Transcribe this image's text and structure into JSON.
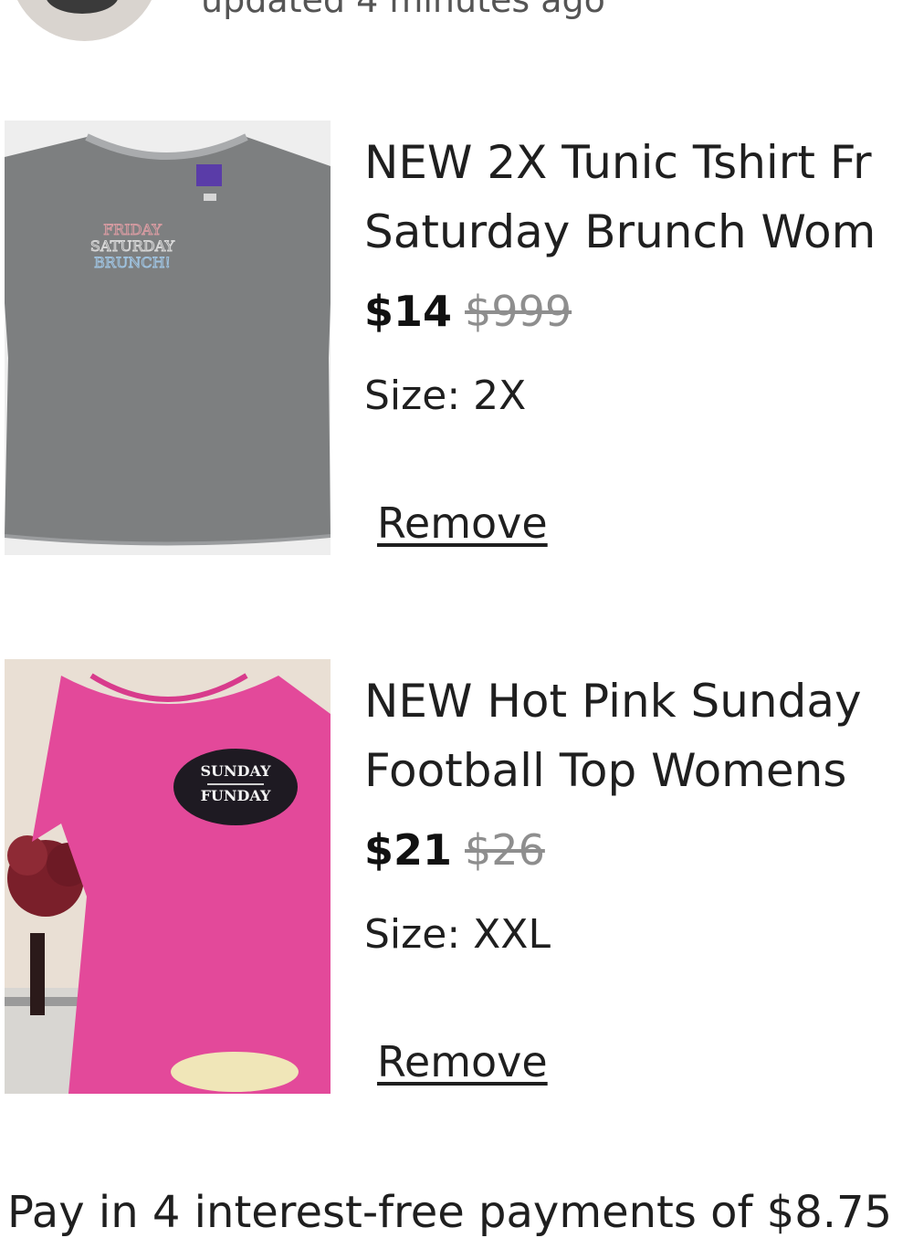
{
  "header": {
    "subtitle": "updated 4 minutes ago"
  },
  "cart": {
    "items": [
      {
        "title_line1": "NEW 2X Tunic Tshirt Fr",
        "title_line2": "Saturday Brunch Wom",
        "price": "$14",
        "original_price": "$999",
        "size_label": "Size:",
        "size_value": "2X",
        "remove_label": "Remove",
        "shirt_text": [
          "FRIDAY",
          "SATURDAY",
          "BRUNCH!"
        ]
      },
      {
        "title_line1": "NEW Hot Pink Sunday",
        "title_line2": "Football Top  Womens",
        "price": "$21",
        "original_price": "$26",
        "size_label": "Size:",
        "size_value": "XXL",
        "remove_label": "Remove",
        "shirt_text": [
          "SUNDAY",
          "FUNDAY"
        ]
      }
    ]
  },
  "footer": {
    "installments_text": "Pay in 4 interest-free payments of $8.75"
  }
}
